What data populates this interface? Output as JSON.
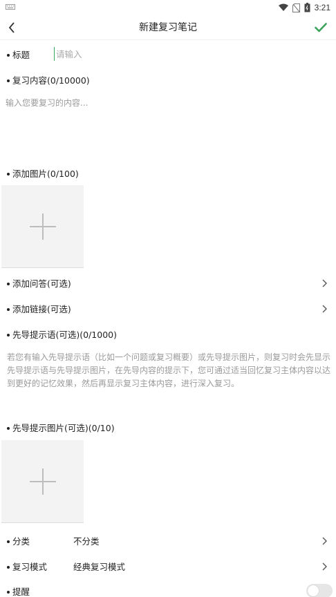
{
  "status_bar": {
    "time": "3:21"
  },
  "header": {
    "title": "新建复习笔记"
  },
  "fields": {
    "title_label": "标题",
    "title_placeholder": "请输入",
    "content_label": "复习内容(0/10000)",
    "content_placeholder": "输入您要复习的内容...",
    "add_image_label": "添加图片(0/100)",
    "add_qa_label": "添加问答(可选)",
    "add_link_label": "添加链接(可选)",
    "hint_label": "先导提示语(可选)(0/1000)",
    "hint_placeholder": "若您有输入先导提示语（比如一个问题或复习概要）或先导提示图片，则复习时会先显示先导提示语与先导提示图片，在先导内容的提示下，您可通过适当回忆复习主体内容以达到更好的记忆效果，然后再显示复习主体内容，进行深入复习。",
    "hint_image_label": "先导提示图片(可选)(0/10)",
    "category_label": "分类",
    "category_value": "不分类",
    "mode_label": "复习模式",
    "mode_value": "经典复习模式",
    "reminder_label": "提醒",
    "reminder_on": false
  },
  "colors": {
    "accent": "#3aa35a",
    "placeholder": "#9a9a9a",
    "image_box": "#f3f3f3"
  }
}
